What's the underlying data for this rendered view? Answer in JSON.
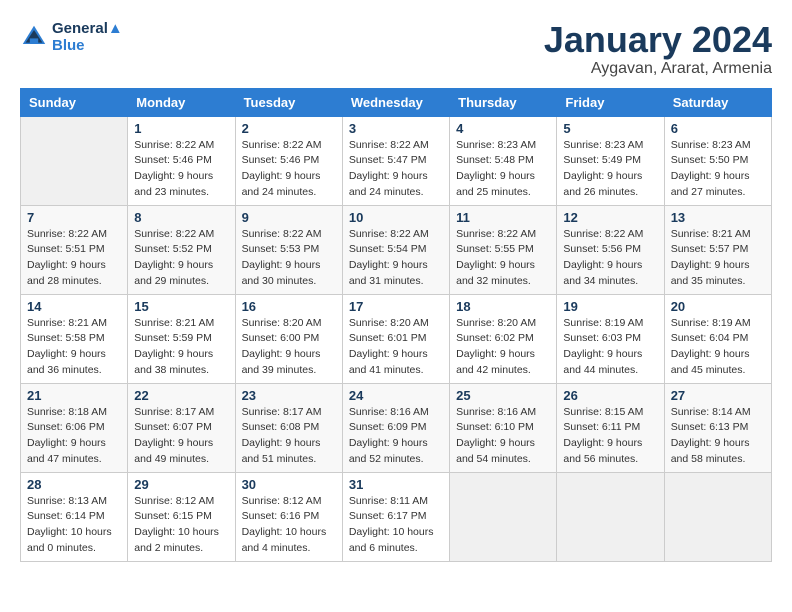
{
  "header": {
    "logo_line1": "General",
    "logo_line2": "Blue",
    "month_title": "January 2024",
    "subtitle": "Aygavan, Ararat, Armenia"
  },
  "days_of_week": [
    "Sunday",
    "Monday",
    "Tuesday",
    "Wednesday",
    "Thursday",
    "Friday",
    "Saturday"
  ],
  "weeks": [
    [
      {
        "day": "",
        "sunrise": "",
        "sunset": "",
        "daylight": ""
      },
      {
        "day": "1",
        "sunrise": "Sunrise: 8:22 AM",
        "sunset": "Sunset: 5:46 PM",
        "daylight": "Daylight: 9 hours and 23 minutes."
      },
      {
        "day": "2",
        "sunrise": "Sunrise: 8:22 AM",
        "sunset": "Sunset: 5:46 PM",
        "daylight": "Daylight: 9 hours and 24 minutes."
      },
      {
        "day": "3",
        "sunrise": "Sunrise: 8:22 AM",
        "sunset": "Sunset: 5:47 PM",
        "daylight": "Daylight: 9 hours and 24 minutes."
      },
      {
        "day": "4",
        "sunrise": "Sunrise: 8:23 AM",
        "sunset": "Sunset: 5:48 PM",
        "daylight": "Daylight: 9 hours and 25 minutes."
      },
      {
        "day": "5",
        "sunrise": "Sunrise: 8:23 AM",
        "sunset": "Sunset: 5:49 PM",
        "daylight": "Daylight: 9 hours and 26 minutes."
      },
      {
        "day": "6",
        "sunrise": "Sunrise: 8:23 AM",
        "sunset": "Sunset: 5:50 PM",
        "daylight": "Daylight: 9 hours and 27 minutes."
      }
    ],
    [
      {
        "day": "7",
        "sunrise": "Sunrise: 8:22 AM",
        "sunset": "Sunset: 5:51 PM",
        "daylight": "Daylight: 9 hours and 28 minutes."
      },
      {
        "day": "8",
        "sunrise": "Sunrise: 8:22 AM",
        "sunset": "Sunset: 5:52 PM",
        "daylight": "Daylight: 9 hours and 29 minutes."
      },
      {
        "day": "9",
        "sunrise": "Sunrise: 8:22 AM",
        "sunset": "Sunset: 5:53 PM",
        "daylight": "Daylight: 9 hours and 30 minutes."
      },
      {
        "day": "10",
        "sunrise": "Sunrise: 8:22 AM",
        "sunset": "Sunset: 5:54 PM",
        "daylight": "Daylight: 9 hours and 31 minutes."
      },
      {
        "day": "11",
        "sunrise": "Sunrise: 8:22 AM",
        "sunset": "Sunset: 5:55 PM",
        "daylight": "Daylight: 9 hours and 32 minutes."
      },
      {
        "day": "12",
        "sunrise": "Sunrise: 8:22 AM",
        "sunset": "Sunset: 5:56 PM",
        "daylight": "Daylight: 9 hours and 34 minutes."
      },
      {
        "day": "13",
        "sunrise": "Sunrise: 8:21 AM",
        "sunset": "Sunset: 5:57 PM",
        "daylight": "Daylight: 9 hours and 35 minutes."
      }
    ],
    [
      {
        "day": "14",
        "sunrise": "Sunrise: 8:21 AM",
        "sunset": "Sunset: 5:58 PM",
        "daylight": "Daylight: 9 hours and 36 minutes."
      },
      {
        "day": "15",
        "sunrise": "Sunrise: 8:21 AM",
        "sunset": "Sunset: 5:59 PM",
        "daylight": "Daylight: 9 hours and 38 minutes."
      },
      {
        "day": "16",
        "sunrise": "Sunrise: 8:20 AM",
        "sunset": "Sunset: 6:00 PM",
        "daylight": "Daylight: 9 hours and 39 minutes."
      },
      {
        "day": "17",
        "sunrise": "Sunrise: 8:20 AM",
        "sunset": "Sunset: 6:01 PM",
        "daylight": "Daylight: 9 hours and 41 minutes."
      },
      {
        "day": "18",
        "sunrise": "Sunrise: 8:20 AM",
        "sunset": "Sunset: 6:02 PM",
        "daylight": "Daylight: 9 hours and 42 minutes."
      },
      {
        "day": "19",
        "sunrise": "Sunrise: 8:19 AM",
        "sunset": "Sunset: 6:03 PM",
        "daylight": "Daylight: 9 hours and 44 minutes."
      },
      {
        "day": "20",
        "sunrise": "Sunrise: 8:19 AM",
        "sunset": "Sunset: 6:04 PM",
        "daylight": "Daylight: 9 hours and 45 minutes."
      }
    ],
    [
      {
        "day": "21",
        "sunrise": "Sunrise: 8:18 AM",
        "sunset": "Sunset: 6:06 PM",
        "daylight": "Daylight: 9 hours and 47 minutes."
      },
      {
        "day": "22",
        "sunrise": "Sunrise: 8:17 AM",
        "sunset": "Sunset: 6:07 PM",
        "daylight": "Daylight: 9 hours and 49 minutes."
      },
      {
        "day": "23",
        "sunrise": "Sunrise: 8:17 AM",
        "sunset": "Sunset: 6:08 PM",
        "daylight": "Daylight: 9 hours and 51 minutes."
      },
      {
        "day": "24",
        "sunrise": "Sunrise: 8:16 AM",
        "sunset": "Sunset: 6:09 PM",
        "daylight": "Daylight: 9 hours and 52 minutes."
      },
      {
        "day": "25",
        "sunrise": "Sunrise: 8:16 AM",
        "sunset": "Sunset: 6:10 PM",
        "daylight": "Daylight: 9 hours and 54 minutes."
      },
      {
        "day": "26",
        "sunrise": "Sunrise: 8:15 AM",
        "sunset": "Sunset: 6:11 PM",
        "daylight": "Daylight: 9 hours and 56 minutes."
      },
      {
        "day": "27",
        "sunrise": "Sunrise: 8:14 AM",
        "sunset": "Sunset: 6:13 PM",
        "daylight": "Daylight: 9 hours and 58 minutes."
      }
    ],
    [
      {
        "day": "28",
        "sunrise": "Sunrise: 8:13 AM",
        "sunset": "Sunset: 6:14 PM",
        "daylight": "Daylight: 10 hours and 0 minutes."
      },
      {
        "day": "29",
        "sunrise": "Sunrise: 8:12 AM",
        "sunset": "Sunset: 6:15 PM",
        "daylight": "Daylight: 10 hours and 2 minutes."
      },
      {
        "day": "30",
        "sunrise": "Sunrise: 8:12 AM",
        "sunset": "Sunset: 6:16 PM",
        "daylight": "Daylight: 10 hours and 4 minutes."
      },
      {
        "day": "31",
        "sunrise": "Sunrise: 8:11 AM",
        "sunset": "Sunset: 6:17 PM",
        "daylight": "Daylight: 10 hours and 6 minutes."
      },
      {
        "day": "",
        "sunrise": "",
        "sunset": "",
        "daylight": ""
      },
      {
        "day": "",
        "sunrise": "",
        "sunset": "",
        "daylight": ""
      },
      {
        "day": "",
        "sunrise": "",
        "sunset": "",
        "daylight": ""
      }
    ]
  ]
}
